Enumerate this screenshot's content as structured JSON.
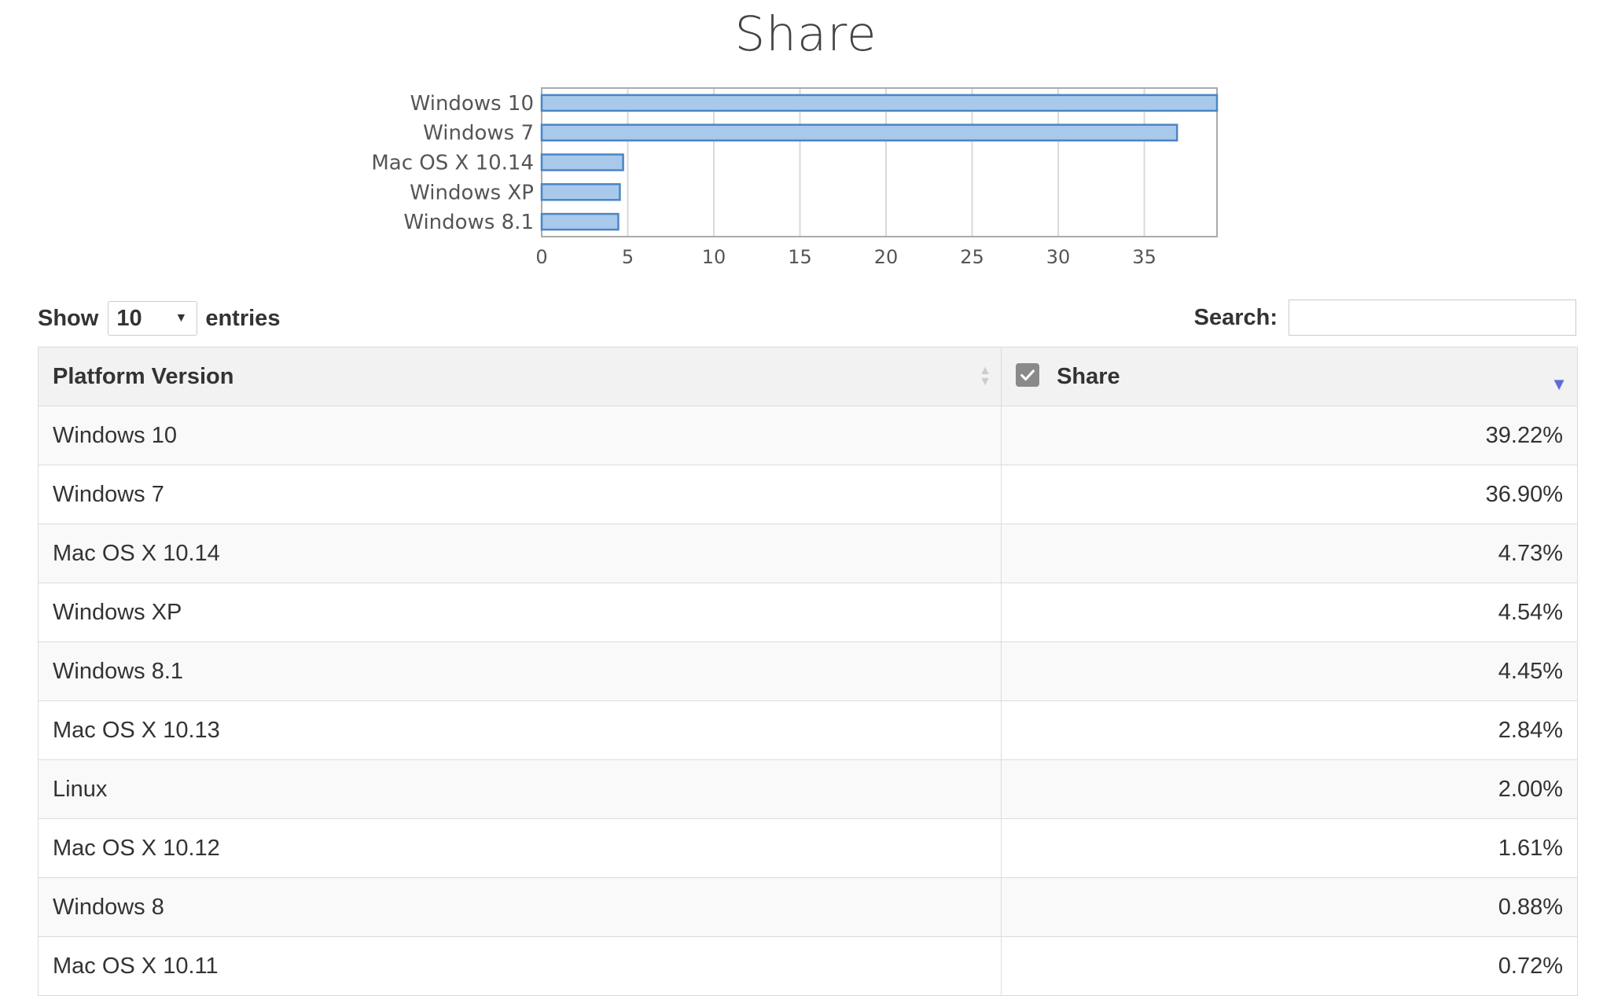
{
  "chart_data": {
    "type": "bar",
    "orientation": "horizontal",
    "title": "Share",
    "categories": [
      "Windows 10",
      "Windows 7",
      "Mac OS X 10.14",
      "Windows XP",
      "Windows 8.1"
    ],
    "values": [
      39.22,
      36.9,
      4.73,
      4.54,
      4.45
    ],
    "xticks": [
      "0",
      "5",
      "10",
      "15",
      "20",
      "25",
      "30",
      "35"
    ],
    "xlim": [
      0,
      39.22
    ],
    "grid": true,
    "colors": {
      "bar_fill": "#a9c9eb",
      "bar_stroke": "#4a86c5",
      "grid": "#d9d9d9",
      "frame": "#aaaaaa"
    }
  },
  "controls": {
    "show_label": "Show",
    "entries_value": "10",
    "entries_label": "entries",
    "search_label": "Search:",
    "search_value": ""
  },
  "table": {
    "headers": {
      "platform": "Platform Version",
      "share": "Share"
    },
    "rows": [
      {
        "platform": "Windows 10",
        "share": "39.22%"
      },
      {
        "platform": "Windows 7",
        "share": "36.90%"
      },
      {
        "platform": "Mac OS X 10.14",
        "share": "4.73%"
      },
      {
        "platform": "Windows XP",
        "share": "4.54%"
      },
      {
        "platform": "Windows 8.1",
        "share": "4.45%"
      },
      {
        "platform": "Mac OS X 10.13",
        "share": "2.84%"
      },
      {
        "platform": "Linux",
        "share": "2.00%"
      },
      {
        "platform": "Mac OS X 10.12",
        "share": "1.61%"
      },
      {
        "platform": "Windows 8",
        "share": "0.88%"
      },
      {
        "platform": "Mac OS X 10.11",
        "share": "0.72%"
      }
    ]
  },
  "icons": {
    "sort_both": "sort-both-icon",
    "sort_desc": "sort-desc-icon",
    "checkbox": "checkbox-checked-icon",
    "dropdown": "caret-down-icon"
  }
}
